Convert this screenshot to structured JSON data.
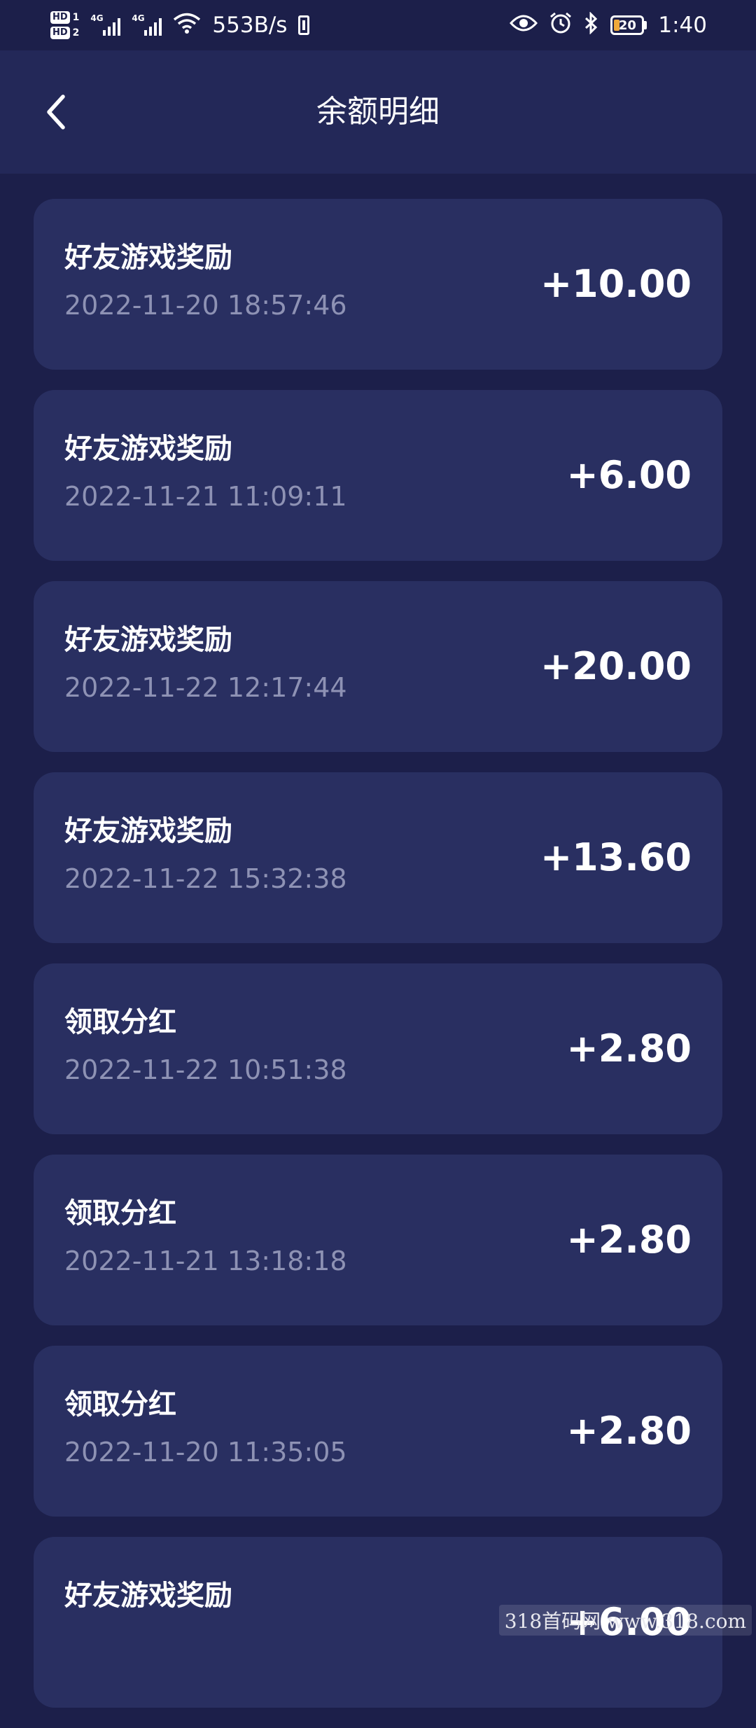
{
  "status_bar": {
    "sim1_label": "HD",
    "sim1_num": "1",
    "sim2_label": "HD",
    "sim2_num": "2",
    "net1": "4G",
    "net2": "4G",
    "speed": "553B/s",
    "battery_level": "20",
    "time": "1:40"
  },
  "header": {
    "title": "余额明细"
  },
  "records": [
    {
      "title": "好友游戏奖励",
      "time": "2022-11-20 18:57:46",
      "amount": "+10.00"
    },
    {
      "title": "好友游戏奖励",
      "time": "2022-11-21 11:09:11",
      "amount": "+6.00"
    },
    {
      "title": "好友游戏奖励",
      "time": "2022-11-22 12:17:44",
      "amount": "+20.00"
    },
    {
      "title": "好友游戏奖励",
      "time": "2022-11-22 15:32:38",
      "amount": "+13.60"
    },
    {
      "title": "领取分红",
      "time": "2022-11-22 10:51:38",
      "amount": "+2.80"
    },
    {
      "title": "领取分红",
      "time": "2022-11-21 13:18:18",
      "amount": "+2.80"
    },
    {
      "title": "领取分红",
      "time": "2022-11-20 11:35:05",
      "amount": "+2.80"
    },
    {
      "title": "好友游戏奖励",
      "time": "",
      "amount": "+6.00"
    }
  ],
  "watermark": "318首码网 www.318.com"
}
